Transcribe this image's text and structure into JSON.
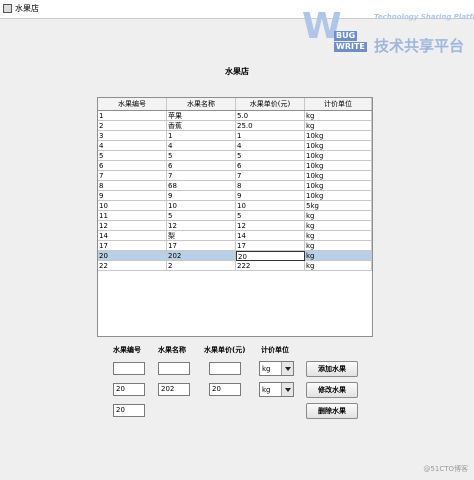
{
  "window": {
    "title": "水果店"
  },
  "watermark": {
    "bug": "BUG",
    "write": "WRITE",
    "tagline": "Technology Sharing Platform",
    "cn": "技术共享平台",
    "footer": "@51CTO博客"
  },
  "page_title": "水果店",
  "table": {
    "columns": [
      "水果编号",
      "水果名称",
      "水果单价(元)",
      "计价单位"
    ],
    "rows": [
      [
        "1",
        "苹果",
        "5.0",
        "kg"
      ],
      [
        "2",
        "香蕉",
        "25.0",
        "kg"
      ],
      [
        "3",
        "1",
        "1",
        "10kg"
      ],
      [
        "4",
        "4",
        "4",
        "10kg"
      ],
      [
        "5",
        "5",
        "5",
        "10kg"
      ],
      [
        "6",
        "6",
        "6",
        "10kg"
      ],
      [
        "7",
        "7",
        "7",
        "10kg"
      ],
      [
        "8",
        "68",
        "8",
        "10kg"
      ],
      [
        "9",
        "9",
        "9",
        "10kg"
      ],
      [
        "10",
        "10",
        "10",
        "5kg"
      ],
      [
        "11",
        "5",
        "5",
        "kg"
      ],
      [
        "12",
        "12",
        "12",
        "kg"
      ],
      [
        "14",
        "梨",
        "14",
        "kg"
      ],
      [
        "17",
        "17",
        "17",
        "kg"
      ],
      [
        "20",
        "202",
        "20",
        "kg"
      ],
      [
        "22",
        "2",
        "222",
        "kg"
      ]
    ],
    "selected_row": 14
  },
  "form": {
    "labels": {
      "id": "水果编号",
      "name": "水果名称",
      "price": "水果单价(元)",
      "unit": "计价单位"
    },
    "add_row": {
      "id": "",
      "name": "",
      "price": "",
      "unit": "kg"
    },
    "edit_row": {
      "id": "20",
      "name": "202",
      "price": "20",
      "unit": "kg"
    },
    "delete_row": {
      "id": "20"
    },
    "buttons": {
      "add": "添加水果",
      "edit": "修改水果",
      "delete": "删除水果"
    }
  }
}
